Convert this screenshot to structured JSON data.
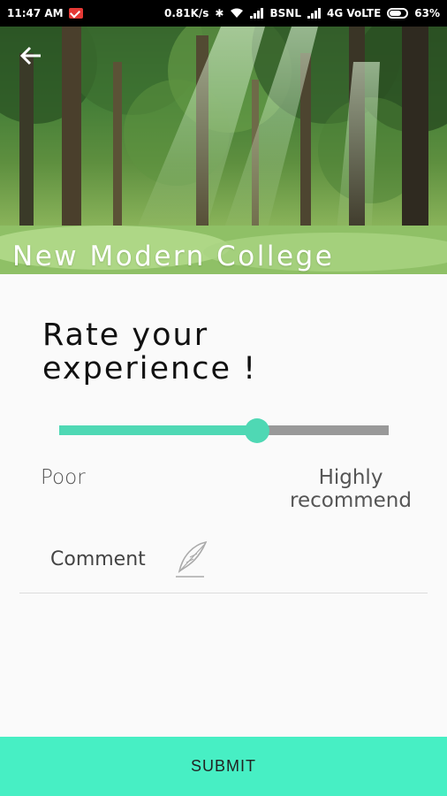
{
  "status_bar": {
    "time": "11:47 AM",
    "speed": "0.81K/s",
    "carrier1": "BSNL",
    "carrier2": "4G VoLTE",
    "battery": "63%",
    "battery_level": 0.63
  },
  "header": {
    "title": "New Modern College",
    "back_icon": "arrow-left-icon"
  },
  "rating": {
    "title": "Rate your experience !",
    "value": 0.6,
    "min_label": "Poor",
    "max_label": "Highly recommend",
    "colors": {
      "accent": "#4fd8b4",
      "track": "#999999"
    }
  },
  "comment": {
    "label": "Comment",
    "icon": "quill-icon"
  },
  "submit": {
    "label": "SUBMIT",
    "color": "#47efc4"
  }
}
